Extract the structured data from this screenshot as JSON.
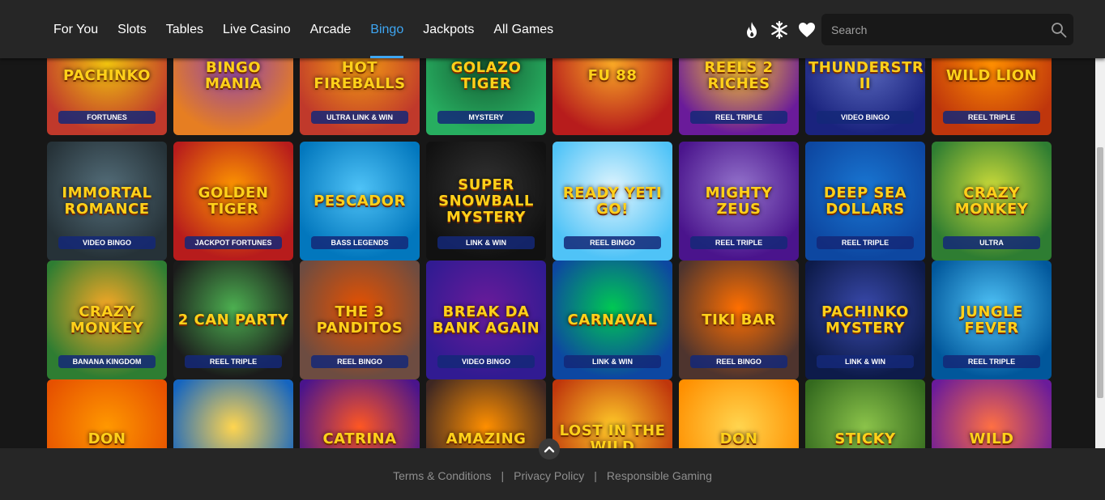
{
  "nav": {
    "items": [
      "For You",
      "Slots",
      "Tables",
      "Live Casino",
      "Arcade",
      "Bingo",
      "Jackpots",
      "All Games"
    ],
    "active": "Bingo"
  },
  "header_icons": [
    "flame-icon",
    "snowflake-icon",
    "heart-icon"
  ],
  "search": {
    "placeholder": "Search",
    "value": ""
  },
  "games": [
    [
      {
        "title": "Pachinko",
        "sub": "Fortunes"
      },
      {
        "title": "Bingo Mania",
        "sub": ""
      },
      {
        "title": "Hot Fireballs",
        "sub": "Ultra Link & Win"
      },
      {
        "title": "Golazo Tiger",
        "sub": "Mystery"
      },
      {
        "title": "Fu 88",
        "sub": ""
      },
      {
        "title": "Reels 2 Riches",
        "sub": "Reel Triple"
      },
      {
        "title": "Thunderstruck II",
        "sub": "Video Bingo"
      },
      {
        "title": "Wild Lion",
        "sub": "Reel Triple"
      }
    ],
    [
      {
        "title": "Immortal Romance",
        "sub": "Video Bingo"
      },
      {
        "title": "Golden Tiger",
        "sub": "Jackpot Fortunes"
      },
      {
        "title": "Pescador",
        "sub": "Bass Legends"
      },
      {
        "title": "Super Snowball Mystery",
        "sub": "Link & Win"
      },
      {
        "title": "Ready Yeti Go!",
        "sub": "Reel Bingo"
      },
      {
        "title": "Mighty Zeus",
        "sub": "Reel Triple"
      },
      {
        "title": "Deep Sea Dollars",
        "sub": "Reel Triple"
      },
      {
        "title": "Crazy Monkey",
        "sub": "Ultra"
      }
    ],
    [
      {
        "title": "Crazy Monkey",
        "sub": "Banana Kingdom"
      },
      {
        "title": "2 Can Party",
        "sub": "Reel Triple"
      },
      {
        "title": "The 3 Panditos",
        "sub": "Reel Bingo"
      },
      {
        "title": "Break da Bank Again",
        "sub": "Video Bingo"
      },
      {
        "title": "Carnaval",
        "sub": "Link & Win"
      },
      {
        "title": "Tiki Bar",
        "sub": "Reel Bingo"
      },
      {
        "title": "Pachinko Mystery",
        "sub": "Link & Win"
      },
      {
        "title": "Jungle Fever",
        "sub": "Reel Triple"
      }
    ],
    [
      {
        "title": "Don",
        "sub": ""
      },
      {
        "title": "",
        "sub": ""
      },
      {
        "title": "Catrina",
        "sub": ""
      },
      {
        "title": "Amazing",
        "sub": ""
      },
      {
        "title": "Lost in the Wild",
        "sub": ""
      },
      {
        "title": "Don",
        "sub": ""
      },
      {
        "title": "Sticky",
        "sub": ""
      },
      {
        "title": "Wild",
        "sub": ""
      }
    ]
  ],
  "footer": {
    "links": [
      "Terms & Conditions",
      "Privacy Policy",
      "Responsible Gaming"
    ]
  },
  "colors": {
    "accent": "#3ea6f2",
    "header_bg": "#262626",
    "page_bg": "#171717"
  }
}
